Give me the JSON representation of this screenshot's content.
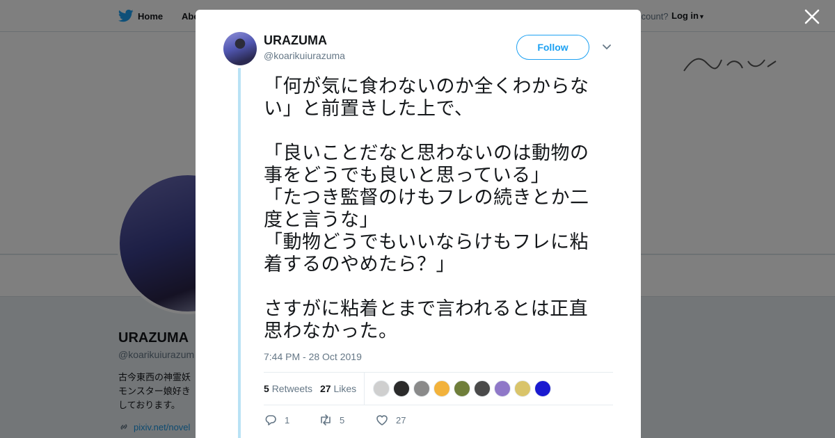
{
  "nav": {
    "home_label": "Home",
    "about_label": "Abo",
    "account_text": "ccount?",
    "login_label": "Log in"
  },
  "profile": {
    "name": "URAZUMA",
    "handle": "@koarikuiurazum",
    "bio": "古今東西の神霊妖\nモンスター娘好き\nしております。",
    "link": "pixiv.net/novel"
  },
  "tweet": {
    "author_name": "URAZUMA",
    "author_handle": "@koarikuiurazuma",
    "follow_label": "Follow",
    "text": "「何が気に食わないのか全くわからない」と前置きした上で、\n\n「良いことだなと思わないのは動物の事をどうでも良いと思っている」\n「たつき監督のけもフレの続きとか二度と言うな」\n「動物どうでもいいならけもフレに粘着するのやめたら？」\n\nさすがに粘着とまで言われるとは正直思わなかった。",
    "timestamp": "7:44 PM - 28 Oct 2019",
    "retweets_count": "5",
    "retweets_label": "Retweets",
    "likes_count": "27",
    "likes_label": "Likes",
    "actions": {
      "reply_count": "1",
      "retweet_count": "5",
      "like_count": "27"
    }
  },
  "colors": {
    "accent": "#1da1f2",
    "thread_line": "#b9e2f5",
    "secondary_text": "#657786",
    "primary_text": "#14171a"
  },
  "likers": [
    {
      "color": "#cfcfcf",
      "icon": "liker-avatar"
    },
    {
      "color": "#2b2b2b",
      "icon": "liker-avatar"
    },
    {
      "color": "#8a8a8a",
      "icon": "liker-avatar"
    },
    {
      "color": "#f2b23b",
      "icon": "liker-avatar"
    },
    {
      "color": "#6f7e3a",
      "icon": "liker-avatar"
    },
    {
      "color": "#4a4a4a",
      "icon": "liker-avatar"
    },
    {
      "color": "#8f78c8",
      "icon": "liker-avatar"
    },
    {
      "color": "#d9c46a",
      "icon": "liker-avatar"
    },
    {
      "color": "#1a1ad0",
      "icon": "liker-avatar"
    }
  ]
}
